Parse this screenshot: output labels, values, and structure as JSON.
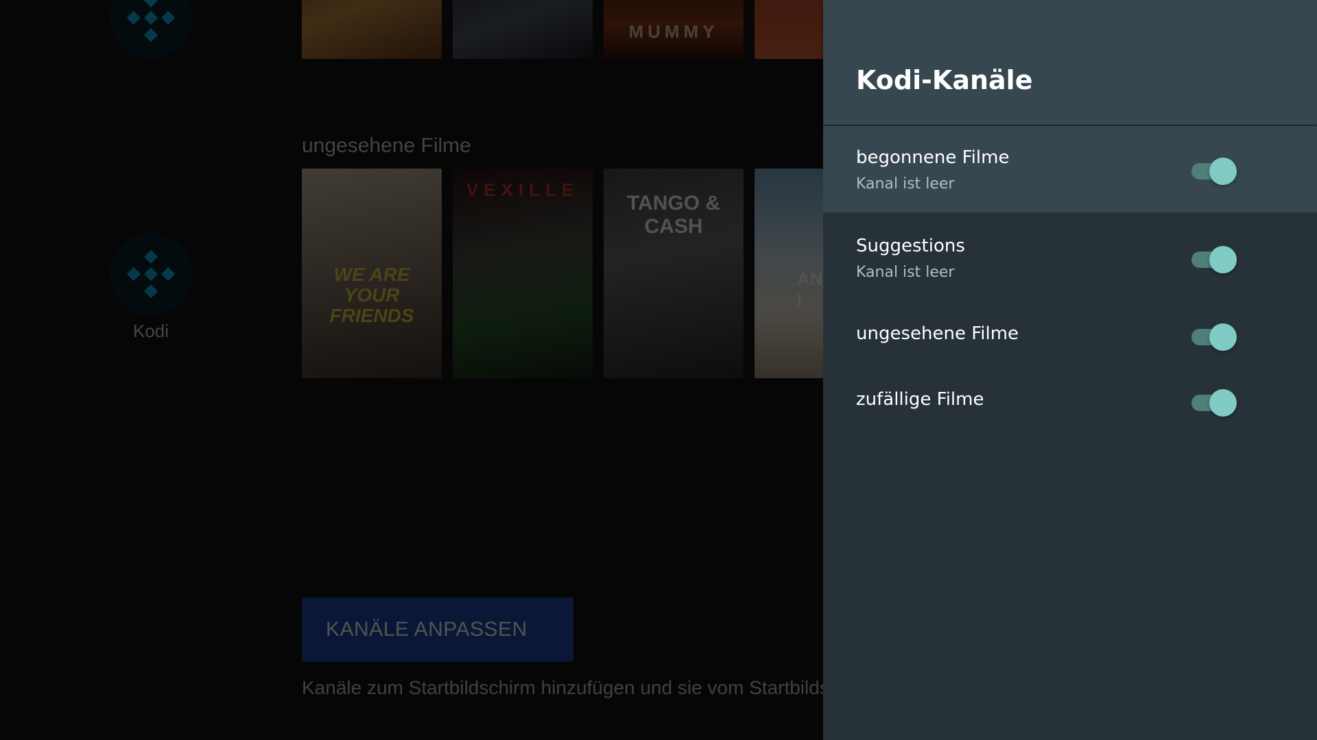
{
  "background": {
    "app_label": "Kodi",
    "row_title": "ungesehene Filme",
    "top_posters": [
      {
        "text": ""
      },
      {
        "text": ""
      },
      {
        "text": "MUMMY"
      },
      {
        "text": ""
      }
    ],
    "row_posters": [
      {
        "text": "WE ARE YOUR FRIENDS"
      },
      {
        "text": "VEXILLE"
      },
      {
        "text": "TANGO & CASH"
      },
      {
        "text": "AN I"
      }
    ],
    "customize_button": "KANÄLE ANPASSEN",
    "customize_hint": "Kanäle zum Startbildschirm hinzufügen und sie vom Startbildschirm entfernen"
  },
  "panel": {
    "title": "Kodi-Kanäle",
    "items": [
      {
        "title": "begonnene Filme",
        "subtitle": "Kanal ist leer",
        "enabled": true,
        "focused": true
      },
      {
        "title": "Suggestions",
        "subtitle": "Kanal ist leer",
        "enabled": true,
        "focused": false
      },
      {
        "title": "ungesehene Filme",
        "subtitle": "",
        "enabled": true,
        "focused": false
      },
      {
        "title": "zufällige Filme",
        "subtitle": "",
        "enabled": true,
        "focused": false
      }
    ]
  },
  "colors": {
    "panel_bg": "#263238",
    "panel_header": "#37474f",
    "toggle_on": "#80cbc4",
    "button_blue": "#1f4aa8"
  },
  "icons": [
    "kodi-logo-icon",
    "toggle-switch-icon"
  ]
}
